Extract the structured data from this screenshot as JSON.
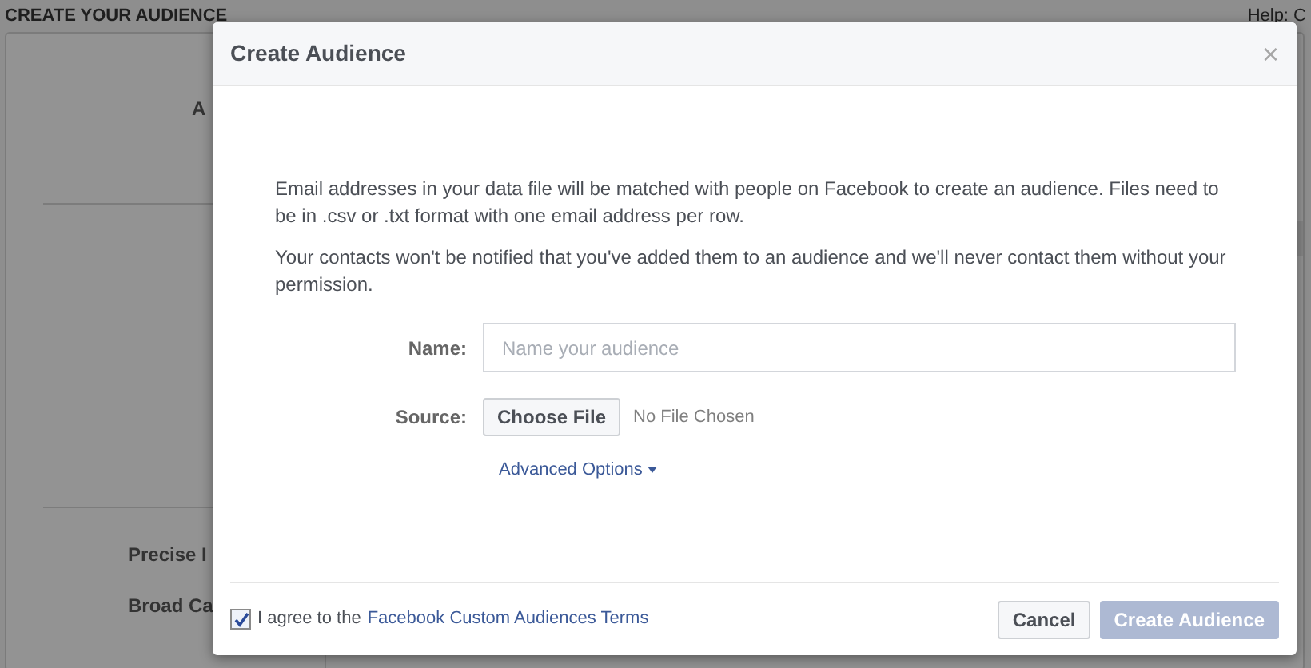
{
  "page": {
    "title": "CREATE YOUR AUDIENCE",
    "help": "Help: C",
    "panel_labels": [
      "A",
      "Precise I",
      "Broad Ca"
    ]
  },
  "dialog": {
    "title": "Create Audience",
    "close": "×",
    "paragraphs": [
      "Email addresses in your data file will be matched with people on Facebook to create an audience. Files need to be in .csv or .txt format with one email address per row.",
      "Your contacts won't be notified that you've added them to an audience and we'll never contact them without your permission."
    ],
    "name_field": {
      "label": "Name:",
      "placeholder": "Name your audience"
    },
    "source_field": {
      "label": "Source:",
      "button": "Choose File",
      "status": "No File Chosen"
    },
    "advanced": {
      "label": "Advanced Options",
      "expanded": false
    },
    "agree": {
      "checked": true,
      "text": "I agree to the",
      "link": "Facebook Custom Audiences Terms"
    },
    "buttons": [
      {
        "label": "Cancel",
        "kind": "secondary",
        "disabled": false
      },
      {
        "label": "Create Audience",
        "kind": "primary",
        "disabled": true
      }
    ]
  }
}
